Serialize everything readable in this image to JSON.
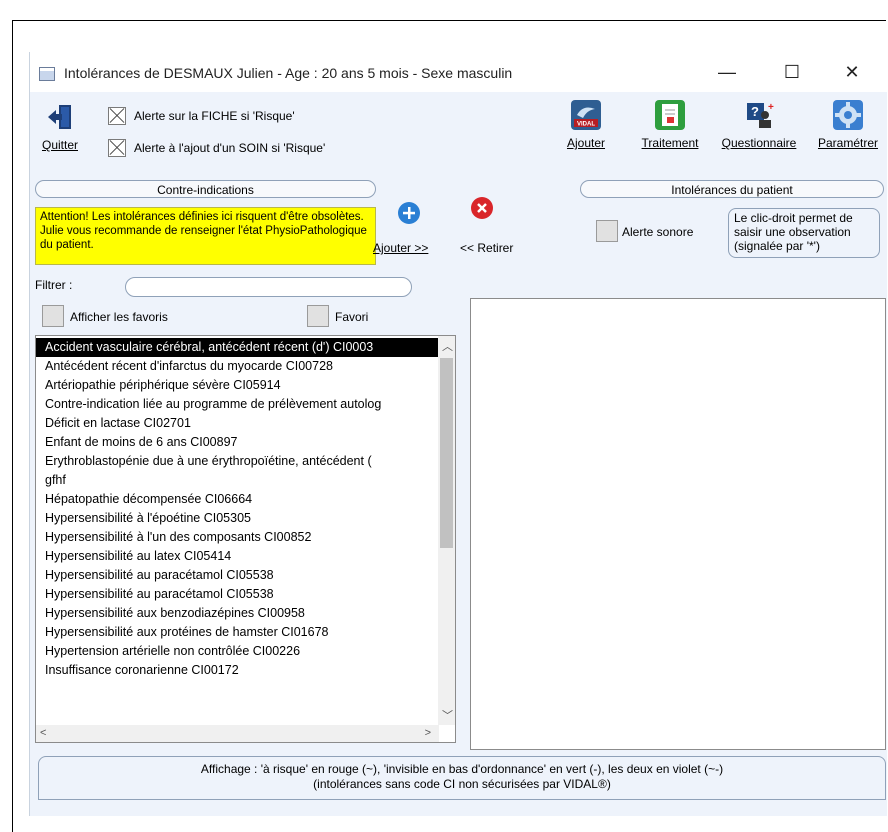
{
  "window": {
    "title": "Intolérances de DESMAUX Julien - Age : 20 ans 5 mois - Sexe masculin",
    "minimize": "—",
    "maximize": "☐",
    "close": "✕"
  },
  "toolbar": {
    "quit_label": "Quitter",
    "alert_fiche_label": "Alerte sur la FICHE si 'Risque'",
    "alert_soin_label": "Alerte à l'ajout d'un SOIN si 'Risque'",
    "ajouter_label": "Ajouter",
    "vidal_badge": "VIDAL",
    "traitement_label": "Traitement",
    "questionnaire_label": "Questionnaire",
    "parametrer_label": "Paramétrer"
  },
  "left": {
    "header": "Contre-indications",
    "warning": "Attention! Les intolérances définies ici risquent d'être obsolètes. Julie vous recommande de renseigner l'état PhysioPathologique du patient.",
    "filter_label": "Filtrer :",
    "filter_value": "",
    "show_favorites_label": "Afficher les favoris",
    "favori_label": "Favori",
    "items": [
      "Accident vasculaire cérébral, antécédent récent (d') CI0003",
      "Antécédent récent d'infarctus du myocarde CI00728",
      "Artériopathie périphérique sévère CI05914",
      "Contre-indication liée au programme de prélèvement autolog",
      "Déficit en lactase CI02701",
      "Enfant de moins de 6 ans CI00897",
      "Erythroblastopénie due à une érythropoïétine, antécédent (",
      "gfhf",
      "Hépatopathie décompensée CI06664",
      "Hypersensibilité à l'époétine CI05305",
      "Hypersensibilité à l'un des composants CI00852",
      "Hypersensibilité au latex CI05414",
      "Hypersensibilité au paracétamol CI05538",
      "Hypersensibilité au paracétamol CI05538",
      "Hypersensibilité aux benzodiazépines CI00958",
      "Hypersensibilité aux protéines de hamster CI01678",
      "Hypertension artérielle non contrôlée CI00226",
      "Insuffisance coronarienne CI00172"
    ]
  },
  "middle": {
    "add_label": "Ajouter >>",
    "remove_label": "<< Retirer"
  },
  "right": {
    "header": "Intolérances du patient",
    "alert_sound_label": "Alerte sonore",
    "note": "Le clic-droit permet de saisir une observation (signalée par '*')"
  },
  "status": {
    "line1": "Affichage : 'à risque' en rouge (~), 'invisible en bas d'ordonnance' en vert (-), les deux en violet (~-)",
    "line2": "(intolérances sans code CI non sécurisées par VIDAL®)"
  },
  "colors": {
    "warning_bg": "#ffff00",
    "window_bg": "#eef3fb",
    "add_icon": "#2a7fd4",
    "remove_icon": "#d9252a"
  }
}
